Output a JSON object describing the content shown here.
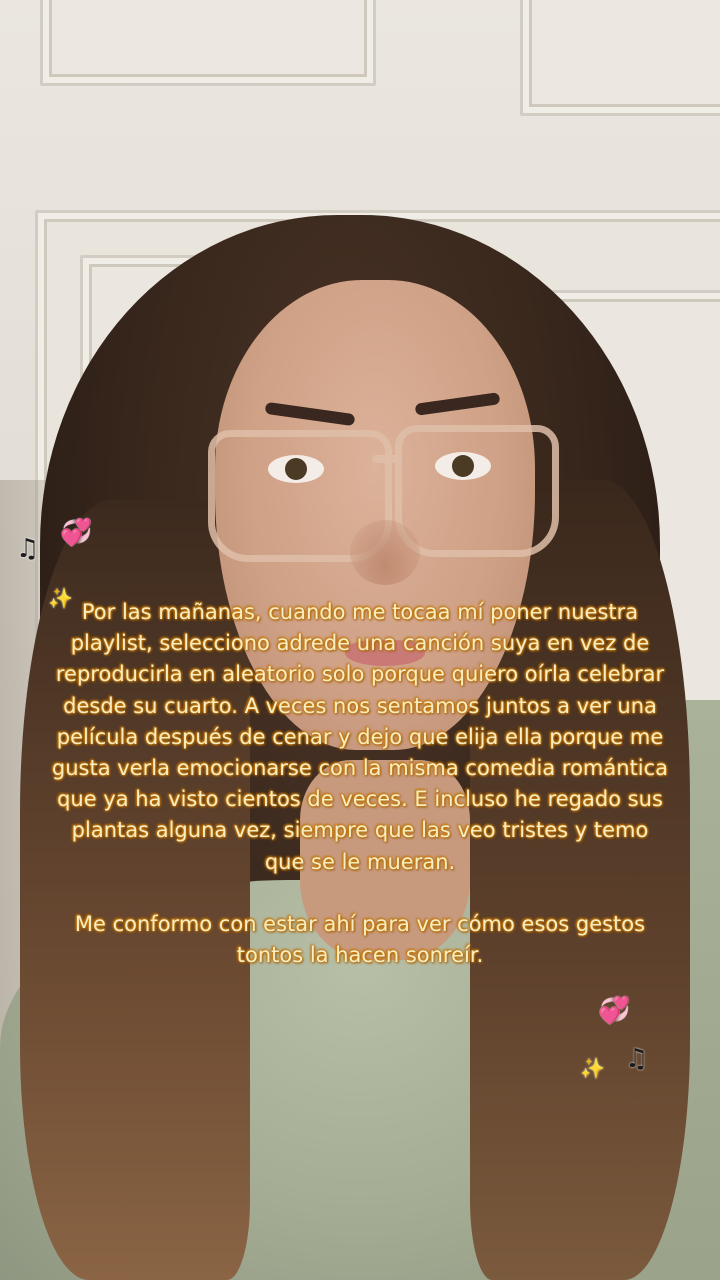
{
  "caption": {
    "paragraph_1": "Por las mañanas, cuando me tocaa mí poner nuestra playlist, selecciono adrede una canción suya en vez de reproducirla en aleatorio solo porque quiero oírla celebrar desde su cuarto. A veces nos sentamos juntos a ver una película después de cenar y dejo que elija ella porque me gusta verla emocionarse con la misma comedia romántica que ya ha visto cientos de veces. E incluso he regado sus plantas alguna vez, siempre que las veo tristes y temo que se le mueran.",
    "paragraph_2": "Me conformo con estar ahí para ver cómo esos gestos tontos la hacen sonreír."
  },
  "stickers": {
    "note_glyph": "♫",
    "heart_glyph": "💞",
    "sparkle_glyph": "✨",
    "icons": [
      "music-note-icon",
      "heart-icon",
      "sparkles-icon"
    ]
  },
  "colors": {
    "caption_text": "#f7edc4",
    "caption_glow": "#d58a12",
    "heart": "#e0308a",
    "sparkle": "#f2c230"
  }
}
